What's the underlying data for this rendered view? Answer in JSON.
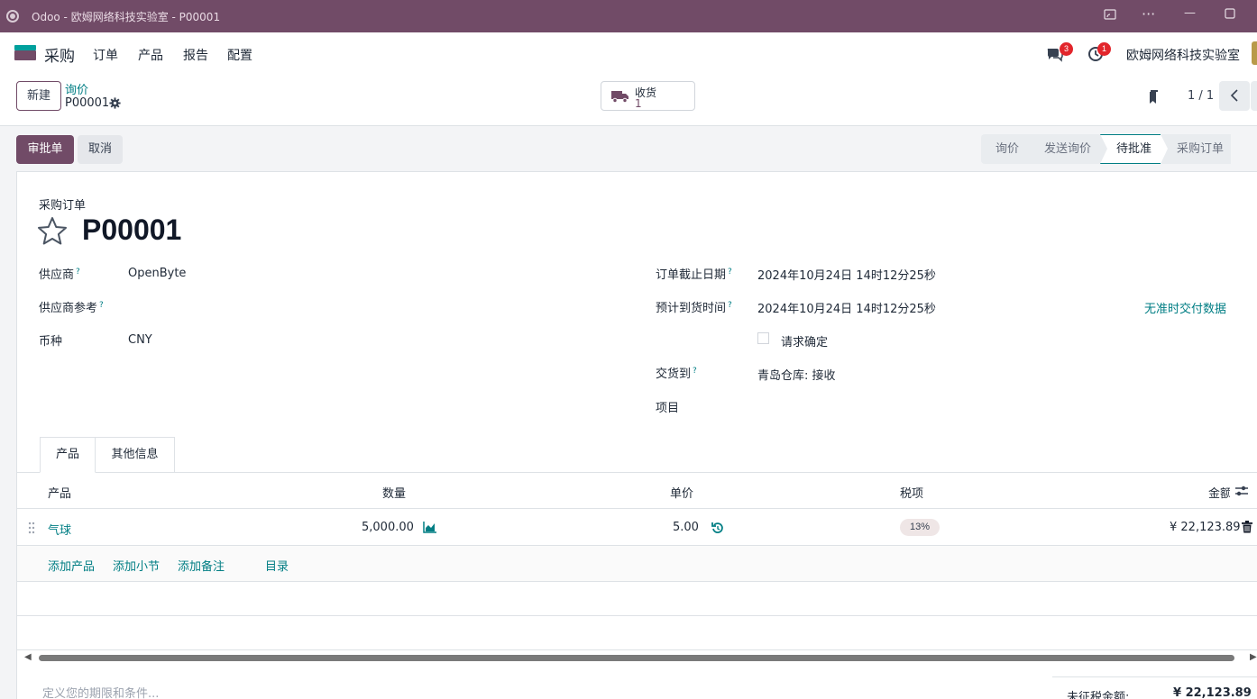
{
  "window": {
    "title": "Odoo - 欧姆网络科技实验室 - P00001",
    "controls": [
      "□⃞",
      "···",
      "—",
      "☐"
    ]
  },
  "navbar": {
    "app_name": "采购",
    "menu": [
      "订单",
      "产品",
      "报告",
      "配置"
    ],
    "messages_badge": "3",
    "activities_badge": "1",
    "company": "欧姆网络科技实验室"
  },
  "control_panel": {
    "new_button": "新建",
    "breadcrumb_parent": "询价",
    "breadcrumb_current": "P00001",
    "smart_button_label": "收货",
    "smart_button_value": "1",
    "pager": "1 / 1"
  },
  "statusbar": {
    "primary_button": "审批单",
    "secondary_button": "取消",
    "steps": [
      {
        "label": "询价",
        "active": false
      },
      {
        "label": "发送询价",
        "active": false
      },
      {
        "label": "待批准",
        "active": true
      },
      {
        "label": "采购订单",
        "active": false
      }
    ]
  },
  "form": {
    "doc_type": "采购订单",
    "doc_name": "P00001",
    "left_fields": [
      {
        "label": "供应商",
        "help": "?",
        "value": "OpenByte"
      },
      {
        "label": "供应商参考",
        "help": "?",
        "value": ""
      },
      {
        "label": "币种",
        "help": "",
        "value": "CNY"
      }
    ],
    "right_fields": [
      {
        "label": "订单截止日期",
        "help": "?",
        "value": "2024年10月24日 14时12分25秒"
      },
      {
        "label": "预计到货时间",
        "help": "?",
        "value": "2024年10月24日 14时12分25秒"
      },
      {
        "label": "交货到",
        "help": "?",
        "value": "青岛仓库: 接收"
      },
      {
        "label": "项目",
        "help": "",
        "value": ""
      }
    ],
    "on_time_link": "无准时交付数据",
    "ask_confirmation_label": "请求确定"
  },
  "tabs": [
    "产品",
    "其他信息"
  ],
  "lines": {
    "headers": [
      "产品",
      "数量",
      "单价",
      "税项",
      "金额"
    ],
    "rows": [
      {
        "product": "气球",
        "quantity": "5,000.00",
        "unit_price": "5.00",
        "tax": "13%",
        "amount": "¥ 22,123.89"
      }
    ],
    "add_links": [
      "添加产品",
      "添加小节",
      "添加备注",
      "目录"
    ]
  },
  "footer": {
    "terms_placeholder": "定义您的期限和条件...",
    "untaxed_label": "未征税金额:",
    "untaxed_value": "¥ 22,123.89"
  },
  "colors": {
    "brand": "#714b67",
    "accent": "#017e84",
    "badge": "#e2252b"
  }
}
